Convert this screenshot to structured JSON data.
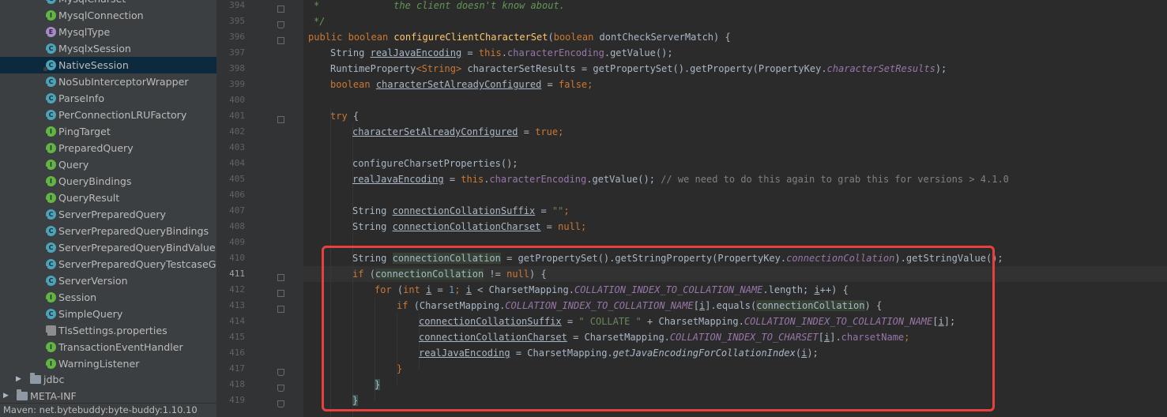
{
  "tree": {
    "items": [
      {
        "label": "MysqlCharset",
        "kind": "c"
      },
      {
        "label": "MysqlConnection",
        "kind": "i"
      },
      {
        "label": "MysqlType",
        "kind": "e"
      },
      {
        "label": "MysqlxSession",
        "kind": "c"
      },
      {
        "label": "NativeSession",
        "kind": "c",
        "selected": true
      },
      {
        "label": "NoSubInterceptorWrapper",
        "kind": "c"
      },
      {
        "label": "ParseInfo",
        "kind": "c"
      },
      {
        "label": "PerConnectionLRUFactory",
        "kind": "c"
      },
      {
        "label": "PingTarget",
        "kind": "i"
      },
      {
        "label": "PreparedQuery",
        "kind": "i"
      },
      {
        "label": "Query",
        "kind": "i"
      },
      {
        "label": "QueryBindings",
        "kind": "i"
      },
      {
        "label": "QueryResult",
        "kind": "i"
      },
      {
        "label": "ServerPreparedQuery",
        "kind": "c"
      },
      {
        "label": "ServerPreparedQueryBindings",
        "kind": "c"
      },
      {
        "label": "ServerPreparedQueryBindValue",
        "kind": "c"
      },
      {
        "label": "ServerPreparedQueryTestcaseGenerator",
        "kind": "c"
      },
      {
        "label": "ServerVersion",
        "kind": "c"
      },
      {
        "label": "Session",
        "kind": "i"
      },
      {
        "label": "SimpleQuery",
        "kind": "c"
      },
      {
        "label": "TlsSettings.properties",
        "kind": "prop"
      },
      {
        "label": "TransactionEventHandler",
        "kind": "i"
      },
      {
        "label": "WarningListener",
        "kind": "i"
      }
    ],
    "folders": [
      {
        "label": "jdbc"
      },
      {
        "label": "META-INF"
      }
    ]
  },
  "status": {
    "text": "Maven: net.bytebuddy:byte-buddy:1.10.10"
  },
  "editor": {
    "line_numbers": [
      "394",
      "395",
      "396",
      "397",
      "398",
      "399",
      "400",
      "401",
      "402",
      "403",
      "404",
      "405",
      "406",
      "407",
      "408",
      "409",
      "410",
      "411",
      "412",
      "413",
      "414",
      "415",
      "416",
      "417",
      "418",
      "419"
    ],
    "current_line": "411",
    "tokens": {
      "doc_star": "*",
      "doc_text": "the client doesn't know about.",
      "doc_end": "*/",
      "public": "public",
      "boolean": "boolean",
      "method_name": "configureClientCharacterSet",
      "param_open": "(",
      "param_name": " dontCheckServerMatch) {",
      "String": "String",
      "realJavaEncoding": "realJavaEncoding",
      "assign": " = ",
      "this": "this",
      "dot": ".",
      "characterEncoding": "characterEncoding",
      "getValue": ".getValue();",
      "runtimeProperty": "RuntimeProperty",
      "generic": "<String>",
      "characterSetResults": " characterSetResults = getPropertySet().getProperty(PropertyKey.",
      "characterSetResultsField": "characterSetResults",
      "close_paren_semi": ");",
      "characterSetAlreadyConfigured": "characterSetAlreadyConfigured",
      "false": "false",
      "true": "true",
      "semi": ";",
      "try": "try",
      "open_brace": " {",
      "configureCharsetProperties": "configureCharsetProperties();",
      "comment_again": "// we need to do this again to grab this for versions > 4.1.0",
      "connectionCollationSuffix": "connectionCollationSuffix",
      "empty_string": "\"\"",
      "connectionCollationCharset": "connectionCollationCharset",
      "null": "null",
      "connectionCollation": "connectionCollation",
      "getStringProperty": " = getPropertySet().getStringProperty(PropertyKey.",
      "connectionCollationField": "connectionCollation",
      "getStringValue": ").getStringValue();",
      "if": "if",
      "neq": " != ",
      "close_paren_brace": ") {",
      "for": "for",
      "int": "int",
      "i": "i",
      "one": "1",
      "lt": " < CharsetMapping.",
      "COLLATION_INDEX_TO_COLLATION_NAME": "COLLATION_INDEX_TO_COLLATION_NAME",
      "length": ".length; ",
      "pp": "++",
      "charsetMapping": "CharsetMapping.",
      "equals": "].equals(",
      "collate_string": "\" COLLATE \"",
      "plus": " + CharsetMapping.",
      "close_idx_semi": "];",
      "COLLATION_INDEX_TO_CHARSET": "COLLATION_INDEX_TO_CHARSET",
      "charsetName": "charsetName",
      "getJavaEncodingForCollationIndex": "getJavaEncodingForCollationIndex",
      "close_brace": "}"
    }
  }
}
